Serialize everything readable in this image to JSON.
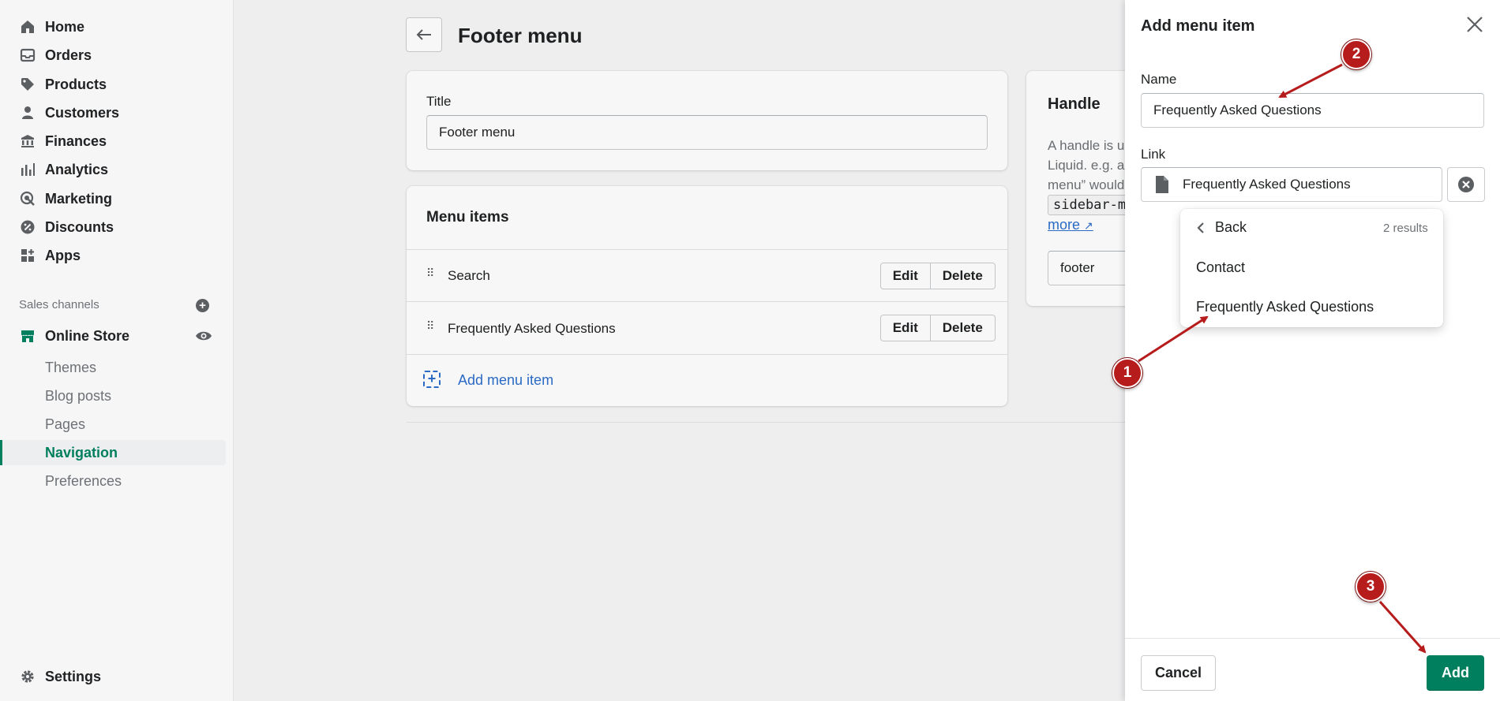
{
  "sidebar": {
    "items": [
      {
        "label": "Home",
        "icon": "home-icon"
      },
      {
        "label": "Orders",
        "icon": "inbox-icon"
      },
      {
        "label": "Products",
        "icon": "tag-icon"
      },
      {
        "label": "Customers",
        "icon": "person-icon"
      },
      {
        "label": "Finances",
        "icon": "bank-icon"
      },
      {
        "label": "Analytics",
        "icon": "bar-chart-icon"
      },
      {
        "label": "Marketing",
        "icon": "target-icon"
      },
      {
        "label": "Discounts",
        "icon": "discount-icon"
      },
      {
        "label": "Apps",
        "icon": "apps-icon"
      }
    ],
    "sales_channels_label": "Sales channels",
    "online_store": "Online Store",
    "sub_items": [
      "Themes",
      "Blog posts",
      "Pages",
      "Navigation",
      "Preferences"
    ],
    "active_sub_item": "Navigation",
    "settings": "Settings"
  },
  "main": {
    "title": "Footer menu",
    "title_card": {
      "label": "Title",
      "value": "Footer menu"
    },
    "menu_items": {
      "heading": "Menu items",
      "rows": [
        {
          "label": "Search",
          "edit": "Edit",
          "delete": "Delete"
        },
        {
          "label": "Frequently Asked Questions",
          "edit": "Edit",
          "delete": "Delete"
        }
      ],
      "add_label": "Add menu item"
    },
    "handle": {
      "heading": "Handle",
      "text_lines": [
        "A handle is u",
        "Liquid. e.g. a",
        "menu” would"
      ],
      "code": "sidebar-m",
      "more": "more",
      "value": "footer"
    }
  },
  "panel": {
    "title": "Add menu item",
    "name_label": "Name",
    "name_value": "Frequently Asked Questions",
    "link_label": "Link",
    "link_value": "Frequently Asked Questions",
    "dropdown": {
      "back": "Back",
      "count": "2 results",
      "options": [
        "Contact",
        "Frequently Asked Questions"
      ]
    },
    "cancel": "Cancel",
    "add": "Add"
  },
  "annotations": [
    "1",
    "2",
    "3"
  ],
  "colors": {
    "accent": "#007f5f",
    "link": "#2c6ecb",
    "marker": "#b71c1c"
  }
}
